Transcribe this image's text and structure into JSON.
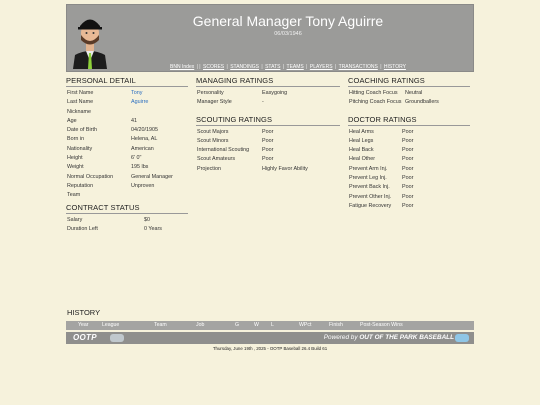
{
  "header": {
    "title": "General Manager Tony Aguirre",
    "subtitle": "06/03/1946",
    "nav": [
      "BNN Index",
      "SCORES",
      "STANDINGS",
      "STATS",
      "TEAMS",
      "PLAYERS",
      "TRANSACTIONS",
      "HISTORY"
    ]
  },
  "personal": {
    "title": "PERSONAL DETAIL",
    "rows": [
      {
        "k": "First Name",
        "v": "Tony"
      },
      {
        "k": "Last Name",
        "v": "Aguirre"
      },
      {
        "k": "Nickname",
        "v": ""
      },
      {
        "k": "Age",
        "v": "41"
      },
      {
        "k": "Date of Birth",
        "v": "04/20/1905"
      },
      {
        "k": "Born in",
        "v": "Helena, AL"
      },
      {
        "k": "Nationality",
        "v": "American"
      },
      {
        "k": "Height",
        "v": "6' 0\""
      },
      {
        "k": "Weight",
        "v": "195 lbs"
      },
      {
        "k": "Normal Occupation",
        "v": "General Manager"
      },
      {
        "k": "Reputation",
        "v": "Unproven"
      },
      {
        "k": "Team",
        "v": ""
      }
    ]
  },
  "contract": {
    "title": "CONTRACT STATUS",
    "rows": [
      {
        "k": "Salary",
        "v": "$0"
      },
      {
        "k": "Duration Left",
        "v": "0 Years"
      }
    ]
  },
  "managing": {
    "title": "MANAGING RATINGS",
    "rows": [
      {
        "k": "Personality",
        "v": "Easygoing"
      },
      {
        "k": "Manager Style",
        "v": "-"
      }
    ]
  },
  "scouting": {
    "title": "SCOUTING RATINGS",
    "rows": [
      {
        "k": "Scout Majors",
        "v": "Poor"
      },
      {
        "k": "Scout Minors",
        "v": "Poor"
      },
      {
        "k": "International Scouting",
        "v": "Poor"
      },
      {
        "k": "Scout Amateurs",
        "v": "Poor"
      },
      {
        "k": "Projection",
        "v": "Highly Favor Ability"
      }
    ]
  },
  "coaching": {
    "title": "COACHING RATINGS",
    "rows": [
      {
        "k": "Hitting Coach Focus",
        "v": "Neutral"
      },
      {
        "k": "Pitching Coach Focus",
        "v": "Groundballers"
      }
    ]
  },
  "doctor": {
    "title": "DOCTOR RATINGS",
    "rows": [
      {
        "k": "Heal Arms",
        "v": "Poor"
      },
      {
        "k": "Heal Legs",
        "v": "Poor"
      },
      {
        "k": "Heal Back",
        "v": "Poor"
      },
      {
        "k": "Heal Other",
        "v": "Poor"
      },
      {
        "k": "Prevent Arm Inj.",
        "v": "Poor"
      },
      {
        "k": "Prevent Leg Inj.",
        "v": "Poor"
      },
      {
        "k": "Prevent Back Inj.",
        "v": "Poor"
      },
      {
        "k": "Prevent Other Inj.",
        "v": "Poor"
      },
      {
        "k": "Fatigue Recovery",
        "v": "Poor"
      }
    ]
  },
  "history": {
    "title": "HISTORY",
    "columns": [
      "Year",
      "League",
      "Team",
      "Job",
      "G",
      "W",
      "L",
      "WPct",
      "Finish",
      "Post-Season Wins"
    ]
  },
  "footer": {
    "logo_text": "OOTP",
    "powered_prefix": "Powered by ",
    "powered_brand": "OUT OF THE PARK BASEBALL",
    "note": "Thursday, June 19th , 2025 - OOTP Baseball 26.4 Build 61"
  },
  "colors": {
    "background": "#f6f2dc",
    "header_bar": "#9b9b99",
    "link": "#2a6ec0"
  }
}
